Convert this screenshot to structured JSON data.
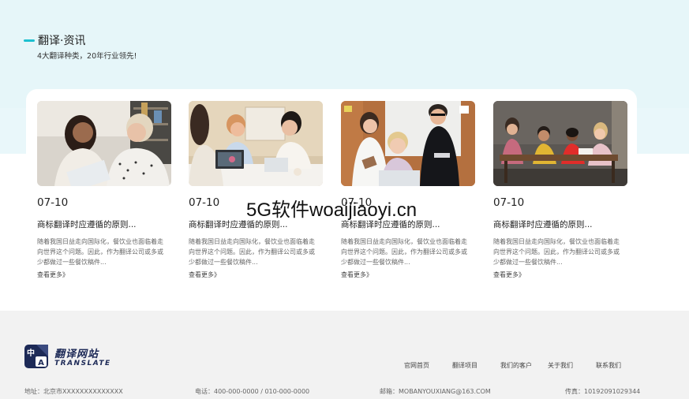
{
  "section": {
    "title": "翻译·资讯",
    "subtitle": "4大翻译种类，20年行业领先!"
  },
  "cards": [
    {
      "date": "07-10",
      "title": "商标翻译时应遵循的原则...",
      "desc": "随着我国日益走向国际化，餐饮业也面临着走向世界这个问题。因此，作为翻译公司或多或少都做过一些餐饮稿件...",
      "more": "查看更多》"
    },
    {
      "date": "07-10",
      "title": "商标翻译时应遵循的原则...",
      "desc": "随着我国日益走向国际化，餐饮业也面临着走向世界这个问题。因此，作为翻译公司或多或少都做过一些餐饮稿件...",
      "more": "查看更多》"
    },
    {
      "date": "07-10",
      "title": "商标翻译时应遵循的原则...",
      "desc": "随着我国日益走向国际化，餐饮业也面临着走向世界这个问题。因此，作为翻译公司或多或少都做过一些餐饮稿件...",
      "more": "查看更多》"
    },
    {
      "date": "07-10",
      "title": "商标翻译时应遵循的原则...",
      "desc": "随着我国日益走向国际化，餐饮业也面临着走向世界这个问题。因此，作为翻译公司或多或少都做过一些餐饮稿件...",
      "more": "查看更多》"
    }
  ],
  "watermark": "5G软件woaijiaoyi.cn",
  "footer": {
    "logo_cn": "翻译网站",
    "logo_en": "TRANSLATE",
    "logo_glyphs": {
      "a": "中",
      "b": "A"
    },
    "nav": [
      "官网首页",
      "翻译项目",
      "我们的客户",
      "关于我们",
      "联系我们"
    ],
    "address": "地址：北京市XXXXXXXXXXXXXX",
    "phone": "电话：400-000-0000 / 010-000-0000",
    "email": "邮箱：MOBANYOUXIANG@163.COM",
    "fax": "传真：10192091029344"
  },
  "colors": {
    "accent": "#1cc0d0",
    "hero_bg": "#e9f7fa",
    "footer_bg": "#f2f2f2",
    "logo": "#1d2a57"
  }
}
